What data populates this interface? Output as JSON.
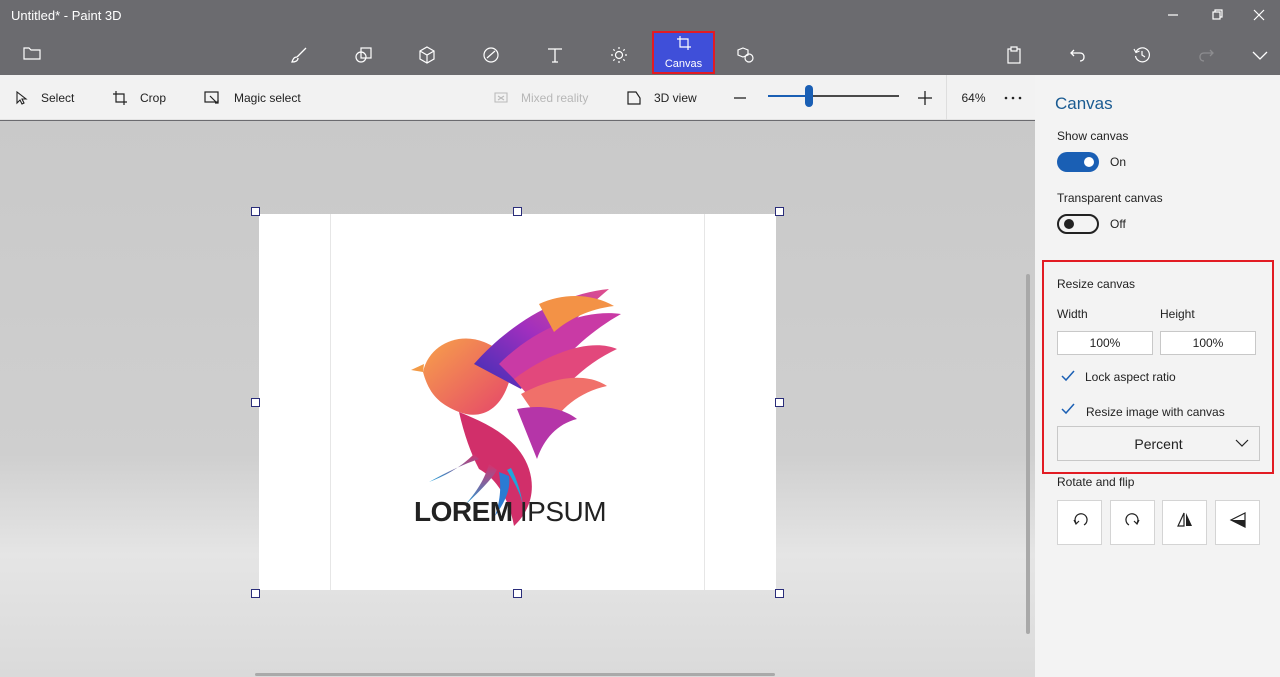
{
  "window": {
    "title": "Untitled* - Paint 3D"
  },
  "toolbar": {
    "canvas_label": "Canvas"
  },
  "subbar": {
    "select_label": "Select",
    "crop_label": "Crop",
    "magic_select_label": "Magic select",
    "mixed_reality_label": "Mixed reality",
    "view3d_label": "3D view",
    "zoom_value": "64%",
    "zoom_level": 0.31
  },
  "canvas": {
    "logo_bold": "LOREM",
    "logo_light": "IPSUM"
  },
  "panel": {
    "title": "Canvas",
    "show_canvas_label": "Show canvas",
    "show_canvas_state": "On",
    "transparent_canvas_label": "Transparent canvas",
    "transparent_canvas_state": "Off",
    "resize_label": "Resize canvas",
    "width_label": "Width",
    "height_label": "Height",
    "width_value": "100%",
    "height_value": "100%",
    "lock_aspect_label": "Lock aspect ratio",
    "resize_image_label": "Resize image with canvas",
    "unit_selected": "Percent",
    "rotate_flip_label": "Rotate and flip"
  },
  "colors": {
    "accent": "#1a5fb4",
    "highlight": "#e21b23",
    "active_tab": "#3f4fd9"
  }
}
